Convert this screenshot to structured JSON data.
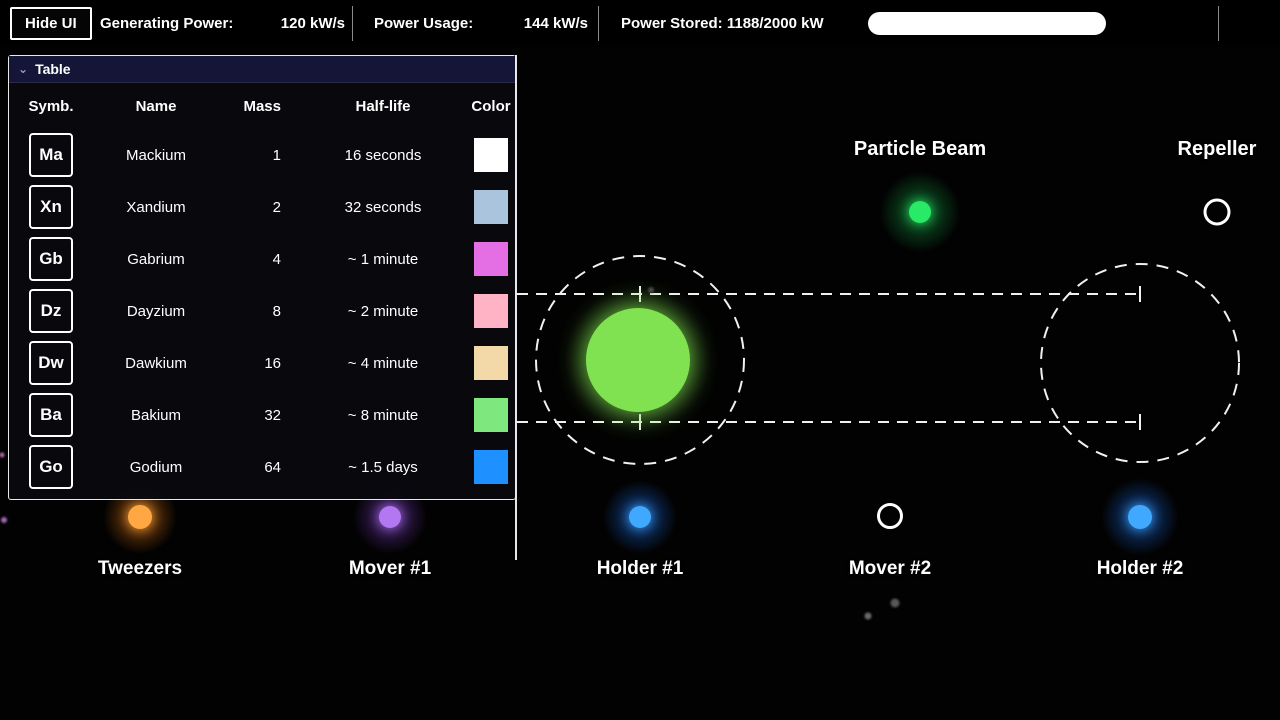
{
  "top_bar": {
    "hide_ui_label": "Hide UI",
    "generating_label": "Generating Power:",
    "generating_value": "120 kW/s",
    "usage_label": "Power Usage:",
    "usage_value": "144 kW/s",
    "stored_label": "Power Stored: 1188/2000 kW",
    "stored_current": 1188,
    "stored_max": 2000,
    "bar_color": "#ffffff"
  },
  "table": {
    "title": "Table",
    "collapse_icon": "⌄",
    "columns": {
      "symbol": "Symb.",
      "name": "Name",
      "mass": "Mass",
      "half_life": "Half-life",
      "color": "Color"
    },
    "rows": [
      {
        "symbol": "Ma",
        "name": "Mackium",
        "mass": "1",
        "half_life": "16 seconds",
        "color": "#ffffff"
      },
      {
        "symbol": "Xn",
        "name": "Xandium",
        "mass": "2",
        "half_life": "32 seconds",
        "color": "#aac4dd"
      },
      {
        "symbol": "Gb",
        "name": "Gabrium",
        "mass": "4",
        "half_life": "~ 1 minute",
        "color": "#e46ee4"
      },
      {
        "symbol": "Dz",
        "name": "Dayzium",
        "mass": "8",
        "half_life": "~ 2 minute",
        "color": "#ffb3c4"
      },
      {
        "symbol": "Dw",
        "name": "Dawkium",
        "mass": "16",
        "half_life": "~ 4 minute",
        "color": "#f3d8a8"
      },
      {
        "symbol": "Ba",
        "name": "Bakium",
        "mass": "32",
        "half_life": "~ 8 minute",
        "color": "#7ee87e"
      },
      {
        "symbol": "Go",
        "name": "Godium",
        "mass": "64",
        "half_life": "~ 1.5 days",
        "color": "#1e90ff"
      }
    ]
  },
  "scene": {
    "beam_label": "Particle Beam",
    "repeller_label": "Repeller",
    "devices": [
      {
        "label": "Tweezers",
        "core": "#ffa843",
        "glow": "rgba(255,130,20,0.55)"
      },
      {
        "label": "Mover #1",
        "core": "#b277f1",
        "glow": "rgba(140,70,220,0.55)"
      },
      {
        "label": "Holder #1",
        "core": "#41a8ff",
        "glow": "rgba(30,120,255,0.55)"
      },
      {
        "label": "Mover #2"
      },
      {
        "label": "Holder #2",
        "core": "#41a8ff",
        "glow": "rgba(30,120,255,0.55)"
      }
    ],
    "beam_particle": {
      "core": "#28ea67",
      "glow": "rgba(25,200,85,0.5)"
    },
    "held_particle": {
      "core": "#80e250",
      "glow": "rgba(110,220,70,0.35)"
    },
    "debris": [
      {
        "color": "#6b6b6b"
      },
      {
        "color": "#585858"
      },
      {
        "color": "#4a4a4a"
      },
      {
        "color": "#b06aa0"
      },
      {
        "color": "#a868b8"
      }
    ]
  }
}
